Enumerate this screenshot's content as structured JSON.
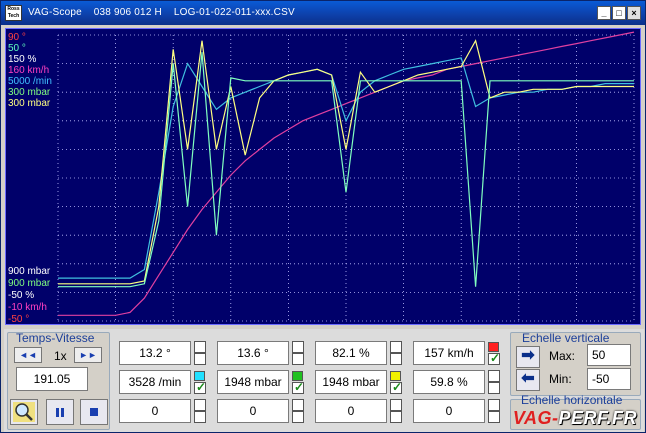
{
  "window": {
    "title": "VAG-Scope    038 906 012 H    LOG-01-022-011-xxx.CSV",
    "icon_text": "Ross Tech",
    "buttons": [
      "minimize-icon",
      "maximize-icon",
      "close-icon"
    ]
  },
  "chart": {
    "y_labels_top": [
      {
        "text": "90 °",
        "color": "#ff4040"
      },
      {
        "text": "50 °",
        "color": "#5fffbf"
      },
      {
        "text": "150 %",
        "color": "#ffffff"
      },
      {
        "text": "160 km/h",
        "color": "#ff40c0"
      },
      {
        "text": "5000 /min",
        "color": "#40c0ff"
      },
      {
        "text": "300 mbar",
        "color": "#80ff80"
      },
      {
        "text": "300 mbar",
        "color": "#ffff80"
      }
    ],
    "y_labels_bottom": [
      {
        "text": "900 mbar",
        "color": "#ffffff"
      },
      {
        "text": "900 mbar",
        "color": "#80ff80"
      },
      {
        "text": "-50 %",
        "color": "#ffffff"
      },
      {
        "text": "-10 km/h",
        "color": "#ff40c0"
      },
      {
        "text": "-50 °",
        "color": "#ff4040"
      }
    ]
  },
  "chart_data": {
    "type": "line",
    "title": "",
    "series": [
      {
        "color": "#e040a0",
        "values": [
          2,
          2,
          2,
          2,
          2,
          3,
          8,
          16,
          24,
          32,
          39,
          45,
          51,
          56,
          60,
          64,
          67,
          70,
          72,
          74,
          76,
          78,
          80,
          82,
          84,
          85,
          86,
          88,
          89,
          90,
          91,
          92,
          93,
          94,
          95,
          96,
          97,
          98,
          99,
          100,
          101
        ]
      },
      {
        "color": "#40c0e0",
        "values": [
          15,
          15,
          15,
          15,
          15,
          15,
          18,
          45,
          75,
          90,
          82,
          74,
          78,
          80,
          82,
          84,
          86,
          87,
          88,
          86,
          70,
          80,
          84,
          86,
          88,
          89,
          90,
          91,
          92,
          75,
          78,
          79,
          80,
          80,
          81,
          81,
          82,
          82,
          83,
          83,
          83
        ]
      },
      {
        "color": "#ffff80",
        "values": [
          13,
          13,
          13,
          13,
          13,
          13,
          14,
          40,
          95,
          60,
          98,
          60,
          82,
          58,
          78,
          84,
          86,
          87,
          88,
          86,
          60,
          87,
          80,
          82,
          84,
          86,
          87,
          88,
          89,
          98,
          78,
          80,
          80,
          81,
          81,
          81,
          82,
          82,
          82,
          82,
          82
        ]
      },
      {
        "color": "#80ffc0",
        "values": [
          12,
          12,
          12,
          12,
          12,
          12,
          13,
          35,
          90,
          40,
          94,
          30,
          85,
          84,
          84,
          84,
          84,
          84,
          84,
          84,
          45,
          84,
          84,
          84,
          84,
          84,
          84,
          84,
          84,
          12,
          84,
          84,
          84,
          84,
          84,
          84,
          84,
          84,
          84,
          84,
          84
        ]
      }
    ]
  },
  "panel": {
    "time_group": {
      "title": "Temps-Vitesse",
      "speed": "1x",
      "time_value": "191.05",
      "rewind": "◄◄",
      "forward": "►►"
    },
    "values_row1": [
      {
        "value": "13.2 °",
        "checked": false,
        "swatch": ""
      },
      {
        "value": "13.6 °",
        "checked": false,
        "swatch": ""
      },
      {
        "value": "82.1 %",
        "checked": false,
        "swatch": ""
      },
      {
        "value": "157 km/h",
        "checked": true,
        "swatch": "#ff2020"
      }
    ],
    "values_row2": [
      {
        "value": "3528 /min",
        "checked": true,
        "swatch": "#20e0ff"
      },
      {
        "value": "1948 mbar",
        "checked": true,
        "swatch": "#20c020"
      },
      {
        "value": "1948 mbar",
        "checked": true,
        "swatch": "#f0f000"
      },
      {
        "value": "59.8 %",
        "checked": false,
        "swatch": ""
      }
    ],
    "values_row3": [
      {
        "value": "0",
        "checked": false
      },
      {
        "value": "0",
        "checked": false
      },
      {
        "value": "0",
        "checked": false
      },
      {
        "value": "0",
        "checked": false
      }
    ],
    "vertical_scale": {
      "title": "Echelle verticale",
      "max_label": "Max:",
      "max_value": "50",
      "min_label": "Min:",
      "min_value": "-50"
    },
    "horizontal_scale": {
      "title": "Echelle horizontale"
    }
  },
  "watermark": {
    "text_a": "VAG-",
    "text_b": "PERF.FR",
    "color_a": "#e02020",
    "color_b": "#ffffff"
  }
}
